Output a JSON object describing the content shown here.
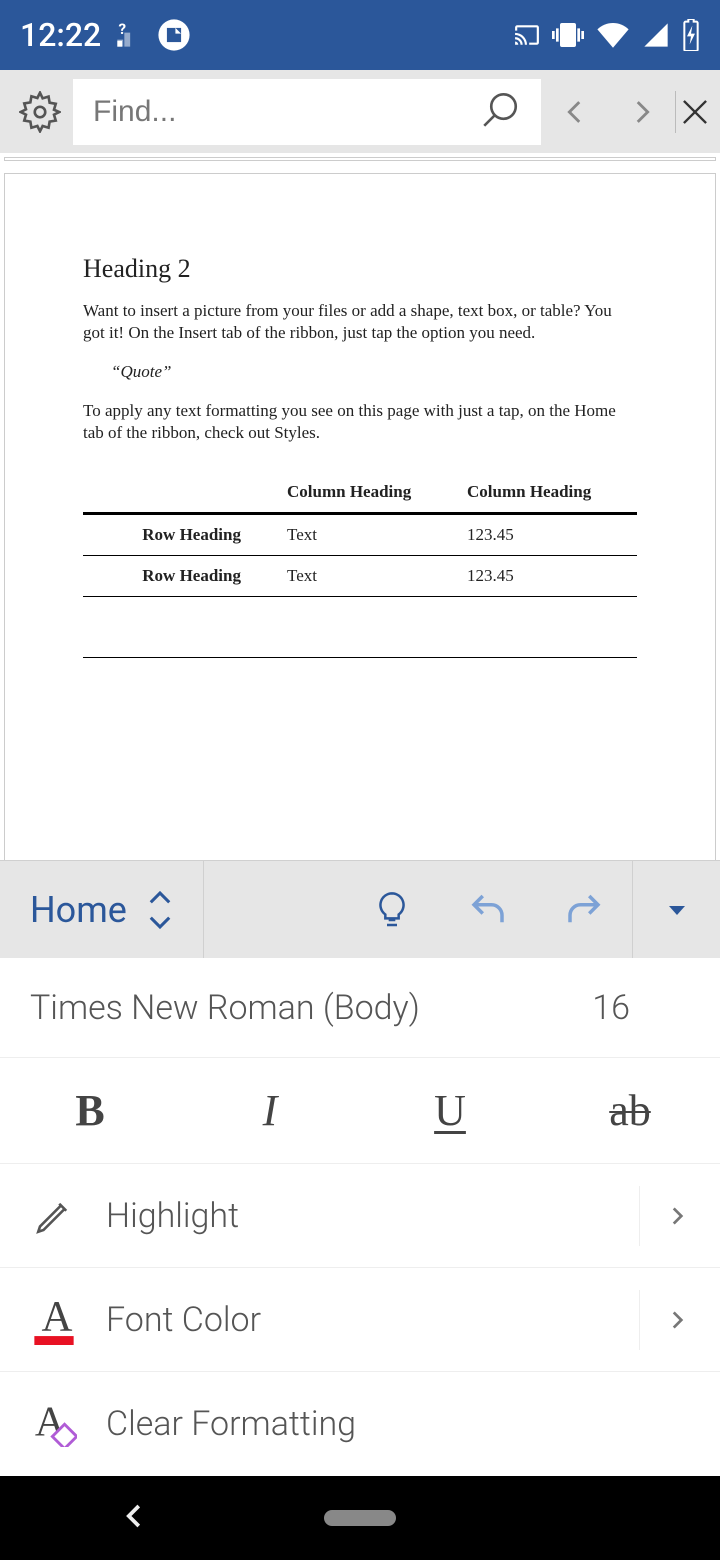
{
  "status": {
    "time": "12:22"
  },
  "find": {
    "placeholder": "Find..."
  },
  "document": {
    "heading": "Heading 2",
    "para1": "Want to insert a picture from your files or add a shape, text box, or table? You got it! On the Insert tab of the ribbon, just tap the option you need.",
    "quote": "“Quote”",
    "para2": "To apply any text formatting you see on this page with just a tap, on the Home tab of the ribbon, check out Styles.",
    "table": {
      "col1": "Column Heading",
      "col2": "Column Heading",
      "rows": [
        {
          "rh": "Row Heading",
          "c1": "Text",
          "c2": "123.45"
        },
        {
          "rh": "Row Heading",
          "c1": "Text",
          "c2": "123.45"
        }
      ]
    }
  },
  "ribbon": {
    "tab": "Home"
  },
  "font": {
    "name": "Times New Roman (Body)",
    "size": "16"
  },
  "styles": {
    "bold": "B",
    "italic": "I",
    "underline": "U",
    "strike": "ab"
  },
  "actions": {
    "highlight": "Highlight",
    "fontcolor": "Font Color",
    "clear": "Clear Formatting"
  }
}
